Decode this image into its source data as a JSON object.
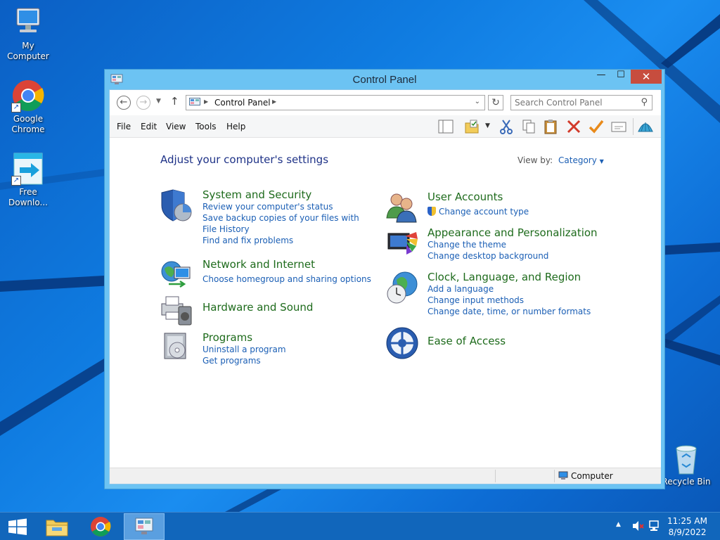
{
  "desktop": {
    "icons": [
      {
        "label": "My Computer",
        "icon": "my-computer-icon"
      },
      {
        "label": "Google Chrome",
        "icon": "chrome-icon"
      },
      {
        "label": "Free Downlo...",
        "icon": "free-download-icon"
      },
      {
        "label": "Recycle Bin",
        "icon": "recycle-bin-icon"
      }
    ]
  },
  "window": {
    "title": "Control Panel",
    "close_glyph": "✕",
    "min_glyph": "—",
    "max_glyph": "☐"
  },
  "address": {
    "breadcrumb": "Control Panel",
    "search_placeholder": "Search Control Panel"
  },
  "menu": {
    "items": [
      "File",
      "Edit",
      "View",
      "Tools",
      "Help"
    ]
  },
  "content": {
    "heading": "Adjust your computer's settings",
    "view_by_label": "View by:",
    "view_by_value": "Category",
    "categories": [
      {
        "title": "System and Security",
        "icon": "shield-icon",
        "links": [
          "Review your computer's status",
          "Save backup copies of your files with File History",
          "Find and fix problems"
        ]
      },
      {
        "title": "Network and Internet",
        "icon": "network-globe-icon",
        "links": [
          "Choose homegroup and sharing options"
        ]
      },
      {
        "title": "Hardware and Sound",
        "icon": "printer-speaker-icon",
        "links": []
      },
      {
        "title": "Programs",
        "icon": "programs-box-icon",
        "links": [
          "Uninstall a program",
          "Get programs"
        ]
      },
      {
        "title": "User Accounts",
        "icon": "users-icon",
        "links": [
          "Change account type"
        ]
      },
      {
        "title": "Appearance and Personalization",
        "icon": "appearance-icon",
        "links": [
          "Change the theme",
          "Change desktop background"
        ]
      },
      {
        "title": "Clock, Language, and Region",
        "icon": "clock-globe-icon",
        "links": [
          "Add a language",
          "Change input methods",
          "Change date, time, or number formats"
        ]
      },
      {
        "title": "Ease of Access",
        "icon": "ease-of-access-icon",
        "links": []
      }
    ]
  },
  "status": {
    "location": "Computer"
  },
  "taskbar": {
    "time": "11:25 AM",
    "date": "8/9/2022"
  },
  "colors": {
    "desktop_bg": "#0f7be0",
    "window_frame": "#6cc3f3",
    "close_button": "#c74d3e",
    "category_title": "#1e6b1c",
    "link": "#1b5fb5",
    "heading": "#1e3287",
    "taskbar": "#1166bb"
  }
}
